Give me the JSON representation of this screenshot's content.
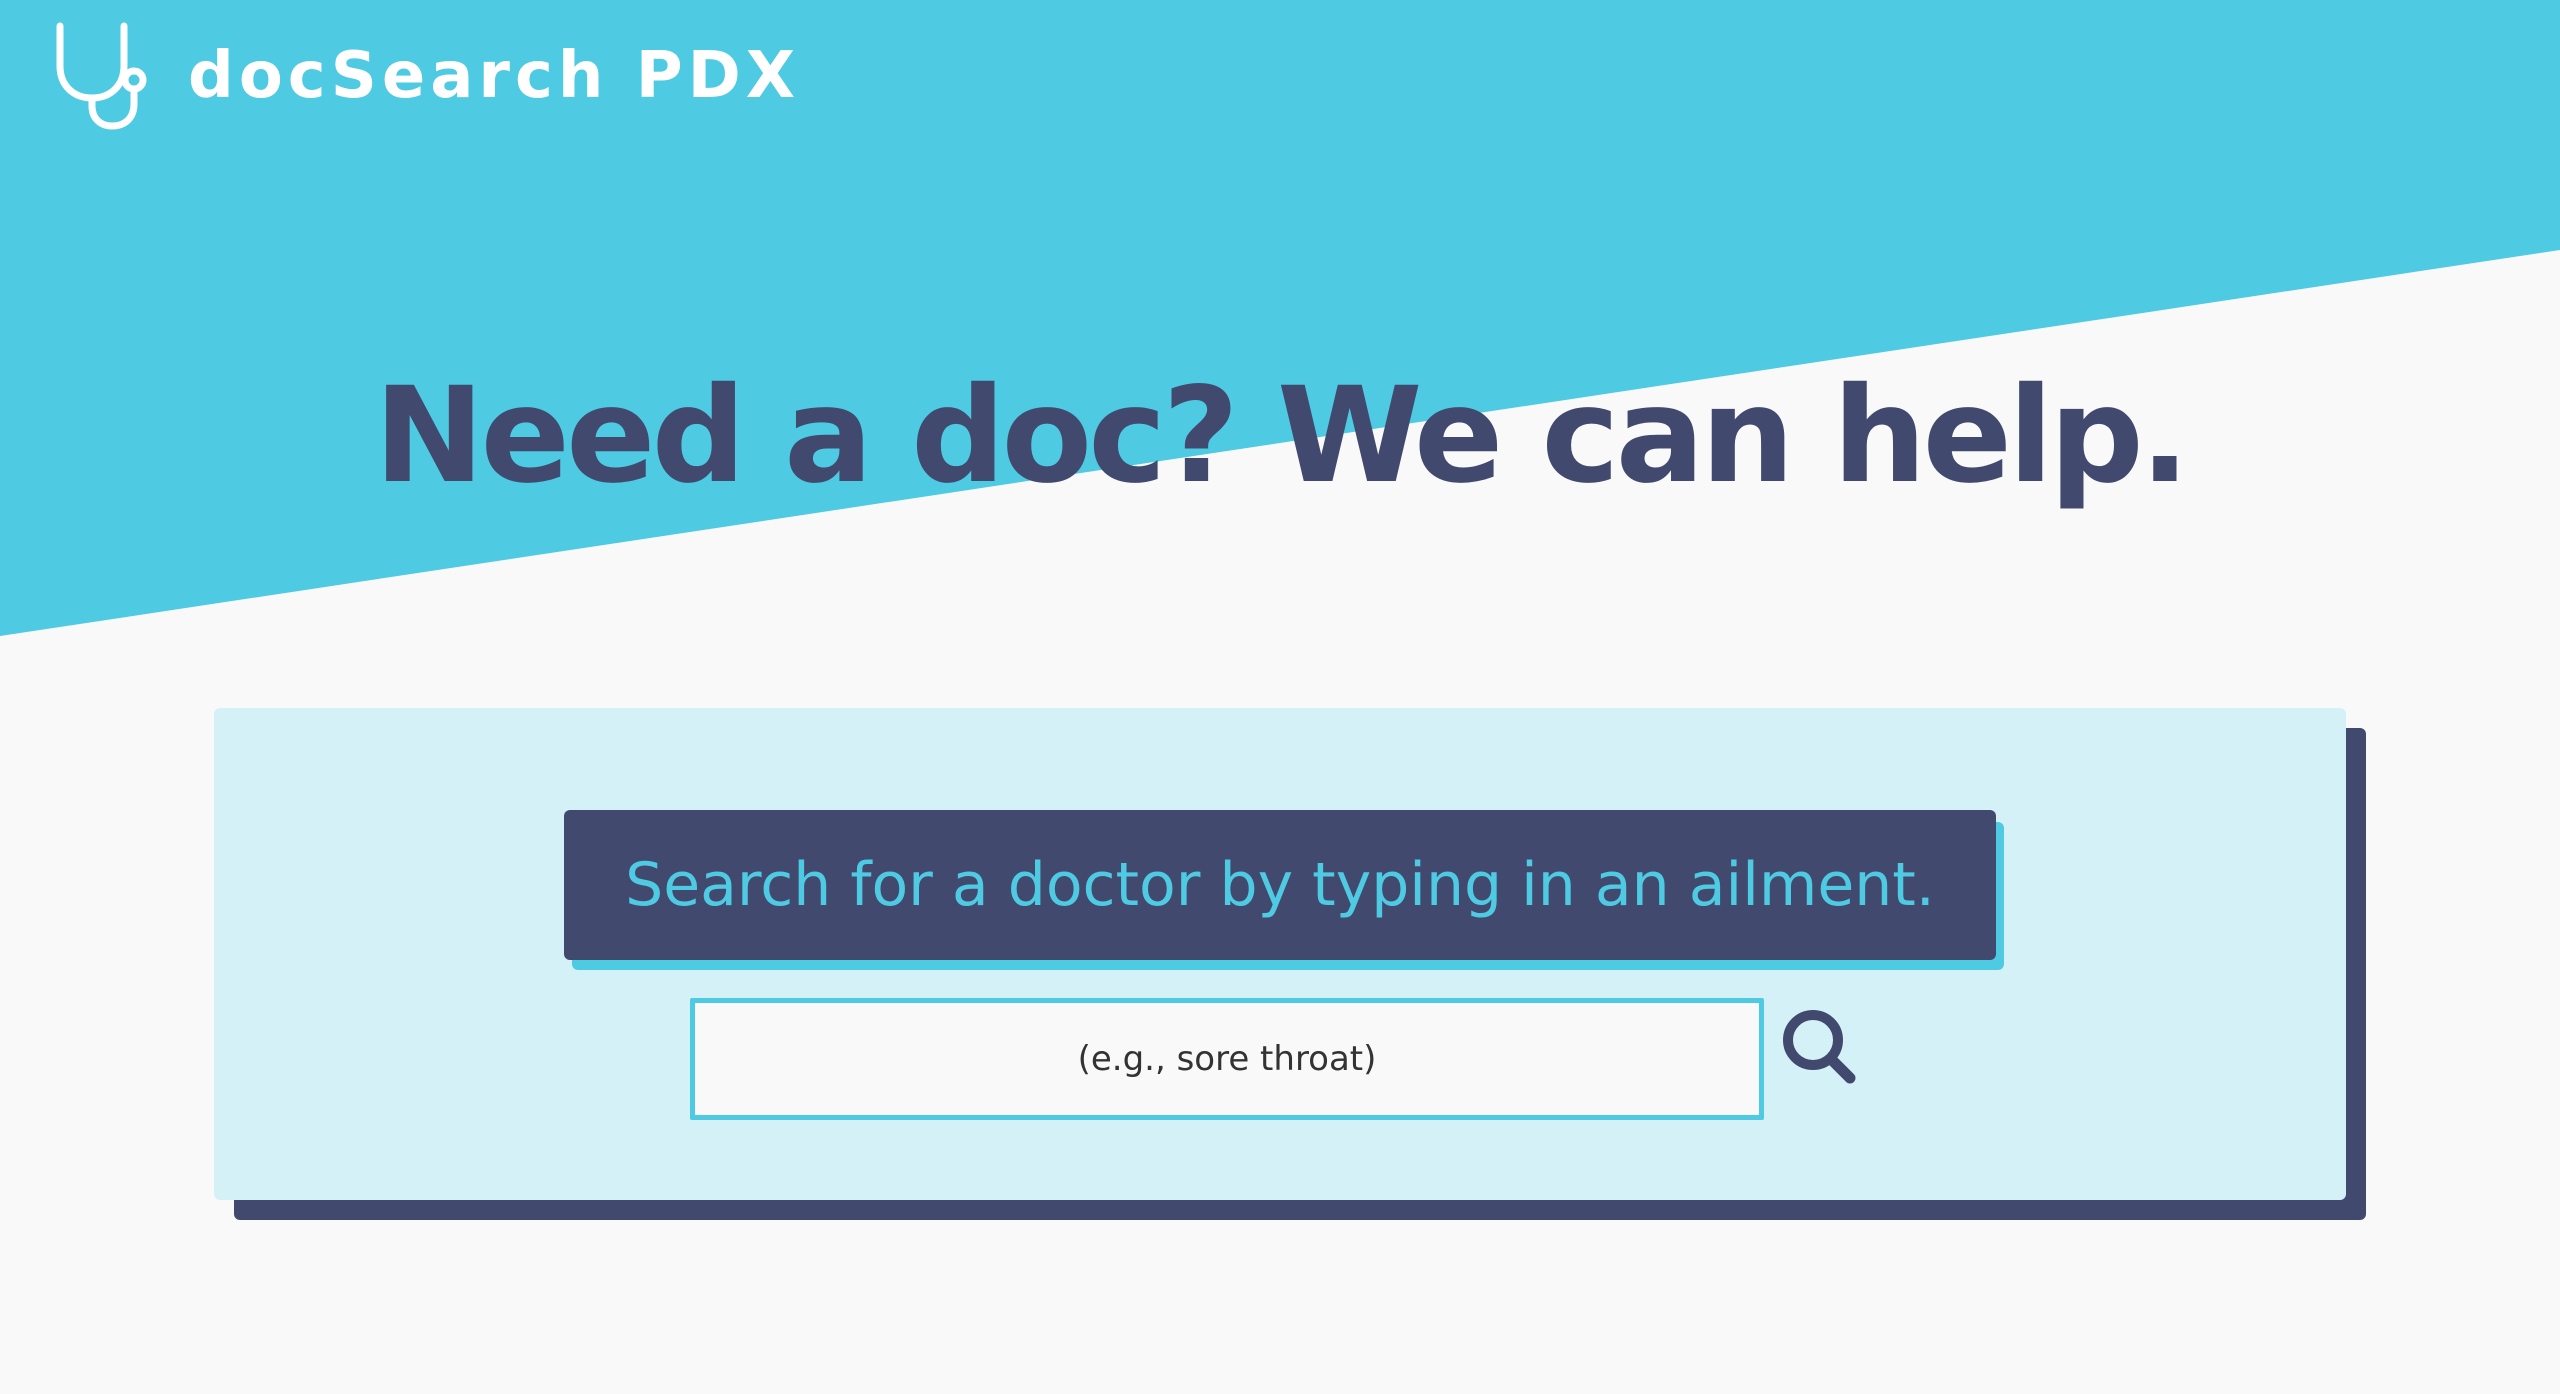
{
  "colors": {
    "sky": "#4ecae3",
    "navy": "#414a6e",
    "background": "#f9f9f9",
    "card": "#d5f1f8",
    "white": "#ffffff"
  },
  "brand": {
    "icon": "stethoscope-icon",
    "name": "docSearch PDX"
  },
  "hero": {
    "headline": "Need a doc? We can help."
  },
  "search": {
    "prompt": "Search for a doctor by typing in an ailment.",
    "placeholder": "(e.g., sore throat)",
    "value": "",
    "button_icon": "search-icon"
  }
}
